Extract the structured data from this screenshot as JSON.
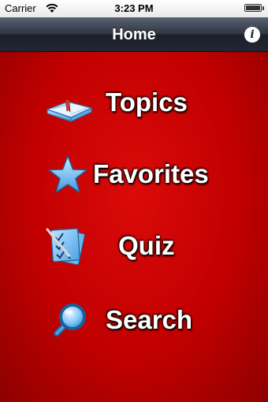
{
  "status_bar": {
    "carrier": "Carrier",
    "time": "3:23 PM",
    "wifi_icon": "wifi-icon",
    "battery_icon": "battery-icon"
  },
  "nav_bar": {
    "title": "Home",
    "info_label": "i",
    "info_icon": "info-icon"
  },
  "menu": {
    "items": [
      {
        "label": "Topics",
        "icon": "book-icon"
      },
      {
        "label": "Favorites",
        "icon": "star-icon"
      },
      {
        "label": "Quiz",
        "icon": "checklist-icon"
      },
      {
        "label": "Search",
        "icon": "magnifier-icon"
      }
    ]
  },
  "colors": {
    "background": "#c10000",
    "nav_bar": "#2e3440",
    "icon_blue": "#7ec8ff",
    "label": "#ffffff"
  }
}
